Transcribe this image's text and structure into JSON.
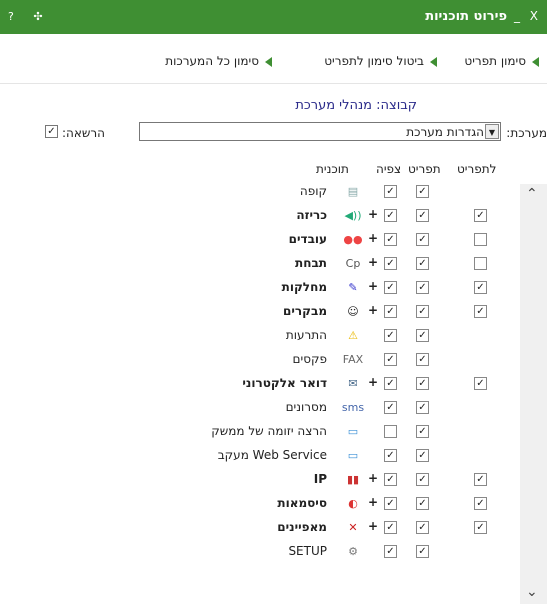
{
  "window": {
    "title": "פירוט תוכניות",
    "controls": "_ X",
    "left_icons": "? ✣"
  },
  "toolbar": {
    "mark_all_systems": "סימון כל המערכות",
    "unmark_menu": "ביטול סימון לתפריט",
    "mark_menu": "סימון תפריט"
  },
  "group_label": "קבוצה: מנהלי מערכת",
  "system": {
    "label": "מערכת:",
    "selected": "הגדרות מערכת"
  },
  "permission": {
    "label": "הרשאה:",
    "checked": true
  },
  "columns": {
    "program": "תוכנית",
    "view": "צפיה",
    "menu": "תפריט",
    "to_menu": "לתפריט"
  },
  "rows": [
    {
      "label": "קופה",
      "bold": false,
      "plus": false,
      "icon": "cash-register-icon",
      "view": true,
      "menu": true,
      "to_menu": null
    },
    {
      "label": "כריזה",
      "bold": true,
      "plus": true,
      "icon": "loudspeaker-icon",
      "view": true,
      "menu": true,
      "to_menu": true
    },
    {
      "label": "עובדים",
      "bold": true,
      "plus": true,
      "icon": "employees-icon",
      "view": true,
      "menu": true,
      "to_menu": false
    },
    {
      "label": "תבחת",
      "bold": true,
      "plus": true,
      "icon": "cp-icon",
      "view": true,
      "menu": true,
      "to_menu": false
    },
    {
      "label": "מחלקות",
      "bold": true,
      "plus": true,
      "icon": "departments-icon",
      "view": true,
      "menu": true,
      "to_menu": true
    },
    {
      "label": "מבקרים",
      "bold": true,
      "plus": true,
      "icon": "visitors-icon",
      "view": true,
      "menu": true,
      "to_menu": true
    },
    {
      "label": "התרעות",
      "bold": false,
      "plus": false,
      "icon": "warning-icon",
      "view": true,
      "menu": true,
      "to_menu": null
    },
    {
      "label": "פקסים",
      "bold": false,
      "plus": false,
      "icon": "fax-icon",
      "view": true,
      "menu": true,
      "to_menu": null
    },
    {
      "label": "דואר אלקטרוני",
      "bold": true,
      "plus": true,
      "icon": "email-icon",
      "view": true,
      "menu": true,
      "to_menu": true
    },
    {
      "label": "מסרונים",
      "bold": false,
      "plus": false,
      "icon": "sms-icon",
      "view": true,
      "menu": true,
      "to_menu": null
    },
    {
      "label": "הרצה יזומה של ממשק",
      "bold": false,
      "plus": false,
      "icon": "interface-run-icon",
      "view": false,
      "menu": true,
      "to_menu": null
    },
    {
      "label": "Web Service מעקב",
      "bold": false,
      "plus": false,
      "icon": "web-service-icon",
      "view": true,
      "menu": true,
      "to_menu": null
    },
    {
      "label": "IP",
      "bold": true,
      "plus": true,
      "icon": "ip-icon",
      "view": true,
      "menu": true,
      "to_menu": true
    },
    {
      "label": "סיסמאות",
      "bold": true,
      "plus": true,
      "icon": "passwords-icon",
      "view": true,
      "menu": true,
      "to_menu": true
    },
    {
      "label": "מאפיינים",
      "bold": true,
      "plus": true,
      "icon": "properties-icon",
      "view": true,
      "menu": true,
      "to_menu": true
    },
    {
      "label": "SETUP",
      "bold": false,
      "plus": false,
      "icon": "setup-icon",
      "view": true,
      "menu": true,
      "to_menu": null
    }
  ],
  "colors": {
    "titlebar": "#3f8f33",
    "accent_arrow": "#3f8f33",
    "group_text": "#2a2a8a"
  }
}
